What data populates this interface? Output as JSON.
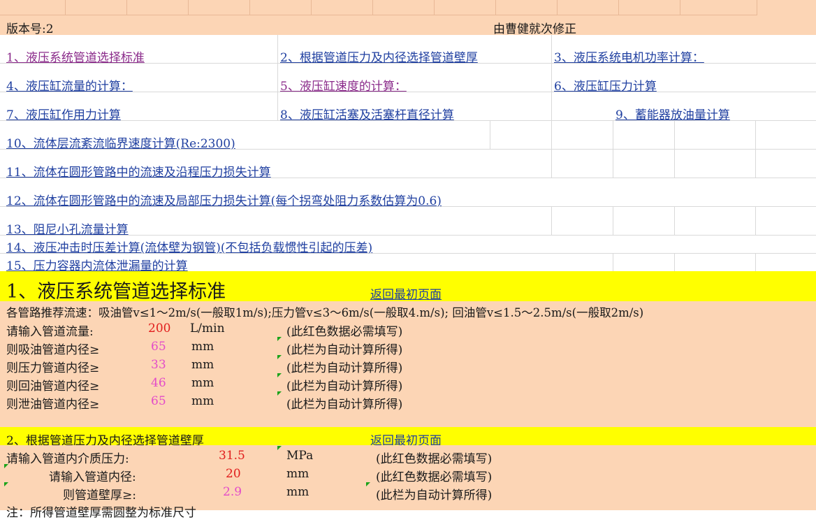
{
  "header": {
    "version": "版本号:2",
    "corrected_by": "由曹健就次修正"
  },
  "index_links": [
    {
      "id": "l1",
      "label": "1、液压系统管道选择标准"
    },
    {
      "id": "l2",
      "label": "2、根据管道压力及内径选择管道壁厚"
    },
    {
      "id": "l3",
      "label": "3、液压系统电机功率计算："
    },
    {
      "id": "l4",
      "label": "4、液压缸流量的计算："
    },
    {
      "id": "l5",
      "label": "5、液压缸速度的计算："
    },
    {
      "id": "l6",
      "label": "6、液压缸压力计算"
    },
    {
      "id": "l7",
      "label": "7、液压缸作用力计算"
    },
    {
      "id": "l8",
      "label": "8、液压缸活塞及活塞杆直径计算"
    },
    {
      "id": "l9",
      "label": "9、蓄能器放油量计算"
    },
    {
      "id": "l10",
      "label": "10、流体层流紊流临界速度计算(Re:2300)"
    },
    {
      "id": "l11",
      "label": "11、流体在圆形管路中的流速及沿程压力损失计算"
    },
    {
      "id": "l12",
      "label": "12、流体在圆形管路中的流速及局部压力损失计算(每个拐弯处阻力系数估算为0.6)"
    },
    {
      "id": "l13",
      "label": "13、阻尼小孔流量计算"
    },
    {
      "id": "l14",
      "label": "14、液压冲击时压差计算(流体壁为钢管)(不包括负载惯性引起的压差)"
    },
    {
      "id": "l15",
      "label": "15、压力容器内流体泄漏量的计算"
    }
  ],
  "section1": {
    "title": "1、液压系统管道选择标准",
    "back_link": "返回最初页面",
    "recommendation": "各管路推荐流速：吸油管v≤1～2m/s(一般取1m/s);压力管v≤3～6m/s(一般取4.m/s); 回油管v≤1.5～2.5m/s(一般取2m/s)",
    "rows": [
      {
        "label": "请输入管道流量:",
        "value": "200",
        "unit": "L/min",
        "note": "(此红色数据必需填写)",
        "kind": "input"
      },
      {
        "label": "则吸油管道内径≥",
        "value": "65",
        "unit": "mm",
        "note": "(此栏为自动计算所得)",
        "kind": "calc"
      },
      {
        "label": "则压力管道内径≥",
        "value": "33",
        "unit": "mm",
        "note": "(此栏为自动计算所得)",
        "kind": "calc"
      },
      {
        "label": "则回油管道内径≥",
        "value": "46",
        "unit": "mm",
        "note": "(此栏为自动计算所得)",
        "kind": "calc"
      },
      {
        "label": "则泄油管道内径≥",
        "value": "65",
        "unit": "mm",
        "note": "(此栏为自动计算所得)",
        "kind": "calc"
      }
    ]
  },
  "section2": {
    "title": "2、根据管道压力及内径选择管道壁厚",
    "back_link": "返回最初页面",
    "rows": [
      {
        "label": "请输入管道内介质压力:",
        "value": "31.5",
        "unit": "MPa",
        "note": "(此红色数据必需填写)",
        "kind": "input"
      },
      {
        "label": "请输入管道内径:",
        "value": "20",
        "unit": "mm",
        "note": "(此红色数据必需填写)",
        "kind": "input"
      },
      {
        "label": "则管道壁厚≥:",
        "value": "2.9",
        "unit": "mm",
        "note": "(此栏为自动计算所得)",
        "kind": "calc"
      }
    ],
    "footnote": "注：所得管道壁厚需圆整为标准尺寸"
  }
}
